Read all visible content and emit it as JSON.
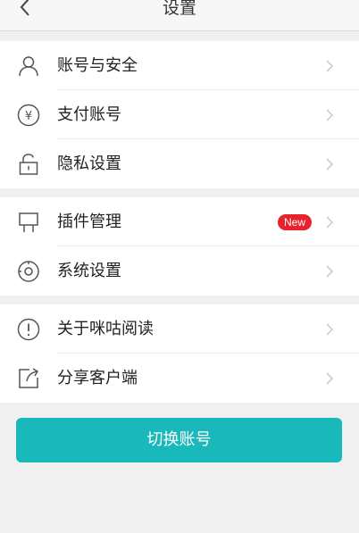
{
  "header": {
    "title": "设置",
    "back_icon": "chevron-left-icon"
  },
  "groups": [
    {
      "items": [
        {
          "label": "账号与安全",
          "icon": "user-icon"
        },
        {
          "label": "支付账号",
          "icon": "yen-icon"
        },
        {
          "label": "隐私设置",
          "icon": "lock-icon"
        }
      ]
    },
    {
      "items": [
        {
          "label": "插件管理",
          "icon": "plugin-icon",
          "badge": "New"
        },
        {
          "label": "系统设置",
          "icon": "settings-icon"
        }
      ]
    },
    {
      "items": [
        {
          "label": "关于咪咕阅读",
          "icon": "info-icon"
        },
        {
          "label": "分享客户端",
          "icon": "share-icon"
        }
      ]
    }
  ],
  "switch_button": {
    "label": "切换账号"
  },
  "colors": {
    "accent": "#19b9bb",
    "badge": "#e8232d",
    "background": "#f0f0f0"
  }
}
